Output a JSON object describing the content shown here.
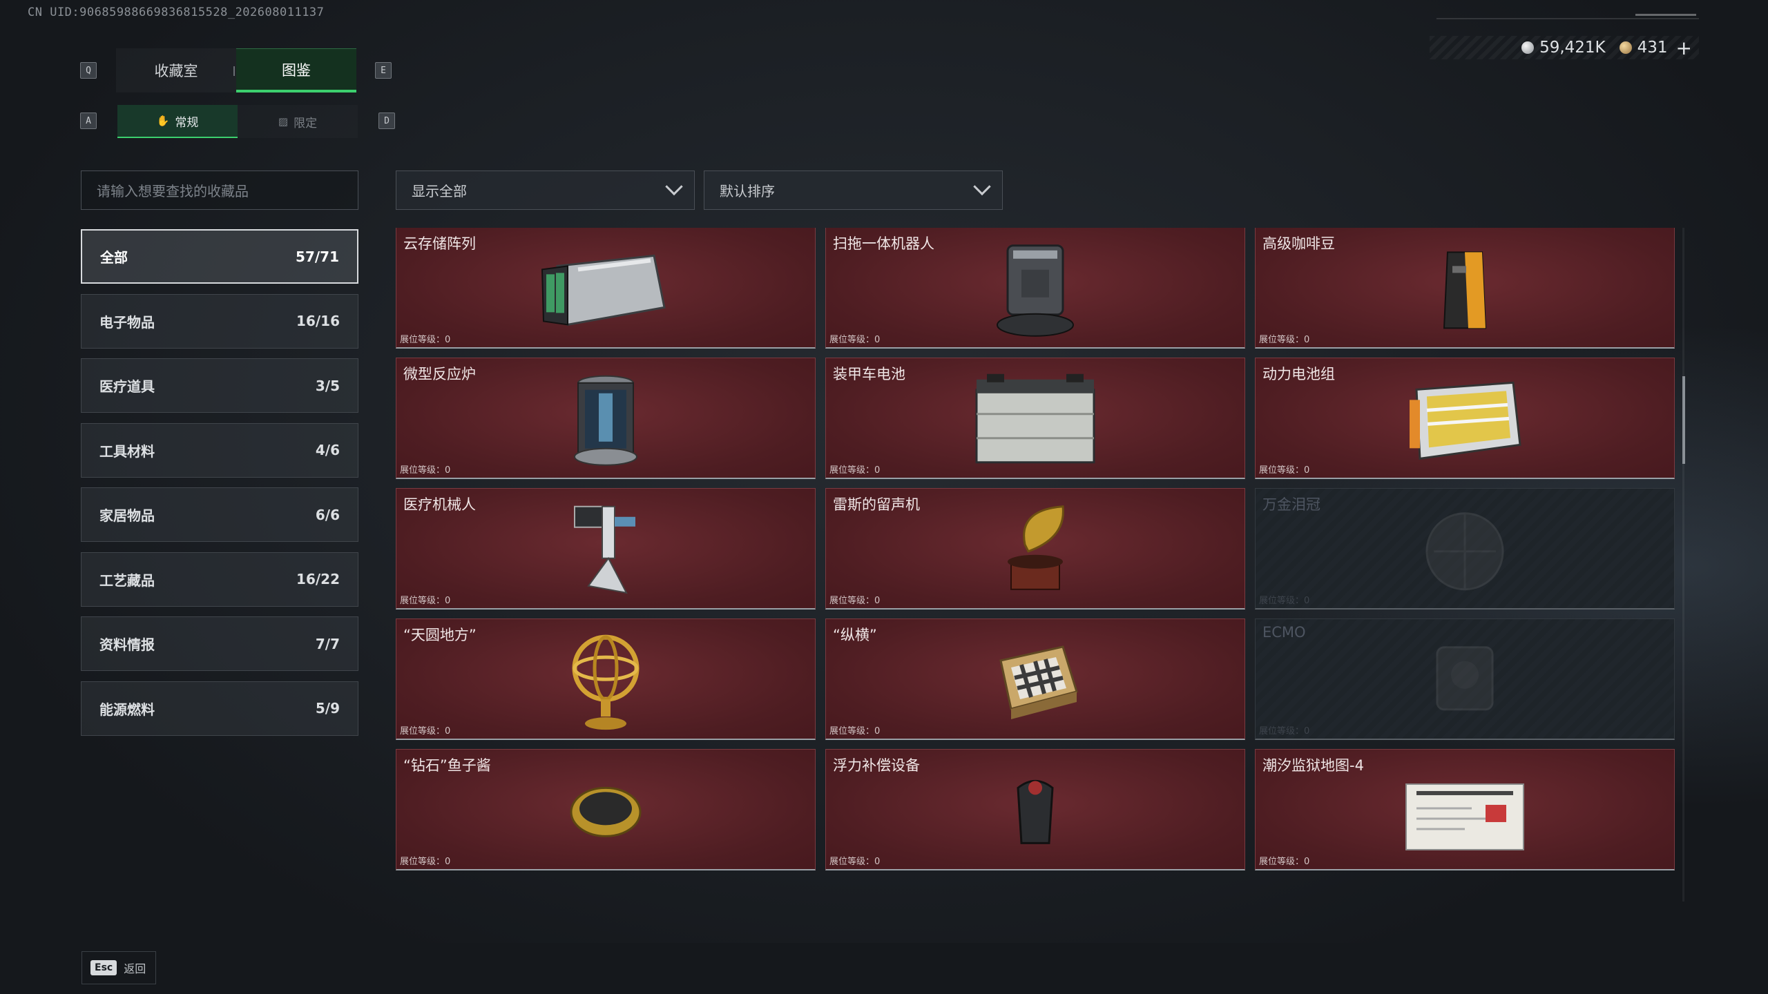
{
  "header": {
    "uid": "CN UID:90685988669836815528_202608011137",
    "currency": [
      {
        "icon": "silver-coin-icon",
        "value": "59,421K"
      },
      {
        "icon": "gold-coin-icon",
        "value": "431"
      }
    ],
    "plus_label": "+"
  },
  "keys": {
    "prev_tab": "Q",
    "next_tab": "E",
    "prev_sub": "A",
    "next_sub": "D"
  },
  "tabs": {
    "main": [
      {
        "label": "收藏室",
        "active": false
      },
      {
        "label": "图鉴",
        "active": true
      }
    ],
    "sub": [
      {
        "label": "常规",
        "icon": "hand-icon",
        "active": true
      },
      {
        "label": "限定",
        "icon": "limited-icon",
        "active": false
      }
    ]
  },
  "search": {
    "placeholder": "请输入想要查找的收藏品"
  },
  "filters": {
    "show": "显示全部",
    "sort": "默认排序"
  },
  "categories": [
    {
      "label": "全部",
      "count": "57/71",
      "active": true
    },
    {
      "label": "电子物品",
      "count": "16/16"
    },
    {
      "label": "医疗道具",
      "count": "3/5"
    },
    {
      "label": "工具材料",
      "count": "4/6"
    },
    {
      "label": "家居物品",
      "count": "6/6"
    },
    {
      "label": "工艺藏品",
      "count": "16/22"
    },
    {
      "label": "资料情报",
      "count": "7/7"
    },
    {
      "label": "能源燃料",
      "count": "5/9"
    }
  ],
  "level_label": "展位等级：0",
  "items": [
    {
      "name": "",
      "icon": "jerrycan-icon",
      "locked": false
    },
    {
      "name": "",
      "icon": "monitor-device-icon",
      "locked": false
    },
    {
      "name": "",
      "icon": "floor-washer-icon",
      "locked": false
    },
    {
      "name": "云存储阵列",
      "icon": "storage-array-icon",
      "locked": false
    },
    {
      "name": "扫拖一体机器人",
      "icon": "robot-vacuum-icon",
      "locked": false
    },
    {
      "name": "高级咖啡豆",
      "icon": "coffee-bag-icon",
      "locked": false
    },
    {
      "name": "微型反应炉",
      "icon": "reactor-icon",
      "locked": false
    },
    {
      "name": "装甲车电池",
      "icon": "battery-icon",
      "locked": false
    },
    {
      "name": "动力电池组",
      "icon": "battery-pack-icon",
      "locked": false
    },
    {
      "name": "医疗机械人",
      "icon": "medical-robot-icon",
      "locked": false
    },
    {
      "name": "雷斯的留声机",
      "icon": "gramophone-icon",
      "locked": false
    },
    {
      "name": "万金泪冠",
      "icon": "crown-icon",
      "locked": true
    },
    {
      "name": "“天圆地方”",
      "icon": "armillary-icon",
      "locked": false
    },
    {
      "name": "“纵横”",
      "icon": "chessboard-icon",
      "locked": false
    },
    {
      "name": "ECMO",
      "icon": "ecmo-icon",
      "locked": true
    },
    {
      "name": "“钻石”鱼子酱",
      "icon": "caviar-icon",
      "locked": false
    },
    {
      "name": "浮力补偿设备",
      "icon": "bcd-icon",
      "locked": false
    },
    {
      "name": "潮汐监狱地图-4",
      "icon": "map-icon",
      "locked": false
    }
  ],
  "footer": {
    "esc_key": "Esc",
    "back_label": "返回"
  },
  "colors": {
    "accent_green": "#3ccf6e",
    "card_red": "#4e1d22"
  }
}
